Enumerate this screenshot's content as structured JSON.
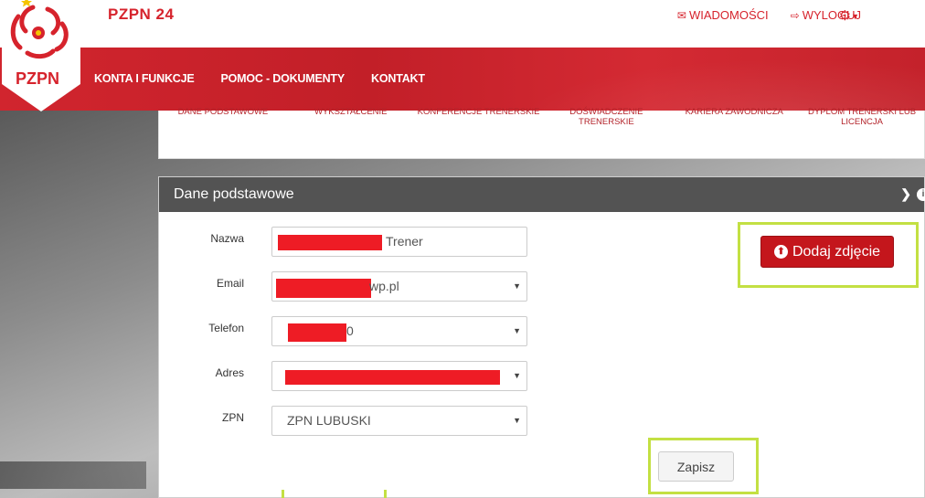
{
  "brand": {
    "title": "PZPN 24",
    "logo_text": "PZPN"
  },
  "top_links": {
    "messages": "WIADOMOŚCI",
    "logout": "WYLOGUJ"
  },
  "nav": {
    "items": [
      "KONTA I FUNKCJE",
      "POMOC - DOKUMENTY",
      "KONTAKT"
    ]
  },
  "steps": [
    "DANE PODSTAWOWE",
    "WYKSZTAŁCENIE",
    "KONFERENCJE TRENERSKIE",
    "DOŚWIADCZENIE TRENERSKIE",
    "KARIERA ZAWODNICZA",
    "DYPLOM TRENERSKI LUB LICENCJA"
  ],
  "panel": {
    "title": "Dane podstawowe",
    "fields": {
      "name": {
        "label": "Nazwa",
        "visible_suffix": "Trener"
      },
      "email": {
        "label": "Email",
        "visible_suffix": "wp.pl"
      },
      "phone": {
        "label": "Telefon",
        "visible_suffix": "0"
      },
      "address": {
        "label": "Adres",
        "visible_suffix": ""
      },
      "zpn": {
        "label": "ZPN",
        "value": "ZPN LUBUSKI"
      }
    },
    "add_photo_label": "Dodaj zdjęcie",
    "save_label": "Zapisz"
  },
  "colors": {
    "brand_red": "#d6232c",
    "panel_header": "#535353",
    "highlight": "#c3e043",
    "redaction": "#ee1c25"
  },
  "icons": {
    "messages": "envelope-icon",
    "logout": "sign-out-icon",
    "settings": "gear-icon",
    "collapse": "chevron-down-icon",
    "info": "info-icon",
    "upload": "upload-circle-icon"
  }
}
